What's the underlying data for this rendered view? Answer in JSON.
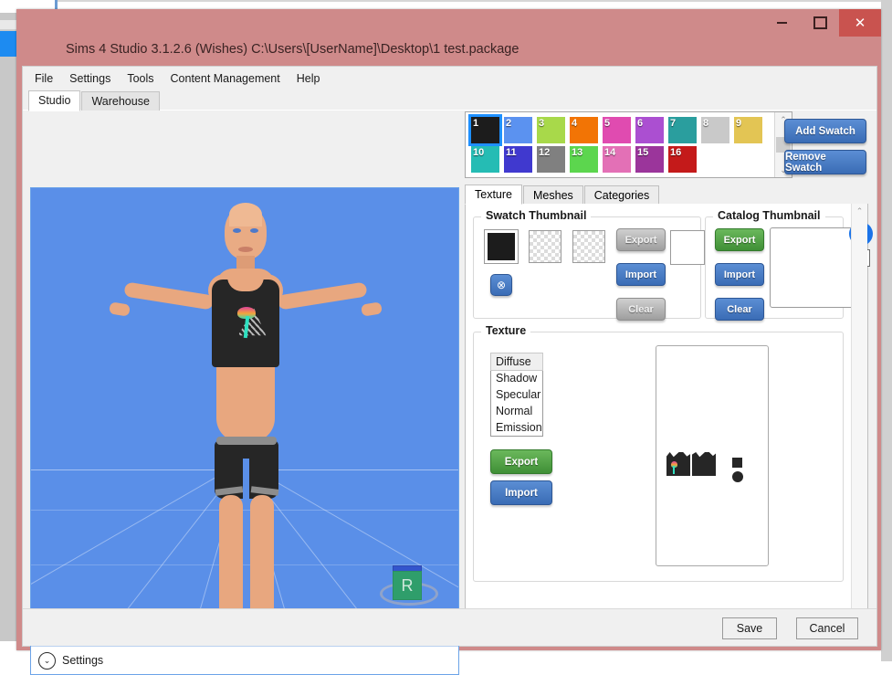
{
  "window": {
    "title": "Sims 4 Studio 3.1.2.6 (Wishes)  C:\\Users\\[UserName]\\Desktop\\1 test.package",
    "controls": {
      "minimize": "—",
      "maximize": "▢",
      "close": "✕"
    },
    "titlebar_color": "#cf8a8a",
    "close_color": "#c9534f"
  },
  "menubar": {
    "items": [
      {
        "label": "File"
      },
      {
        "label": "Settings"
      },
      {
        "label": "Tools"
      },
      {
        "label": "Content Management"
      },
      {
        "label": "Help"
      }
    ]
  },
  "main_tabs": [
    {
      "label": "Studio",
      "active": true
    },
    {
      "label": "Warehouse",
      "active": false
    }
  ],
  "viewport": {
    "settings_label": "Settings",
    "chevron": "⌄",
    "gizmo_label": "R",
    "background_color": "#5a8fe8",
    "gizmo_color": "#2f9e6b"
  },
  "swatches": {
    "items": [
      {
        "n": "1",
        "color": "#1c1c1c",
        "selected": true
      },
      {
        "n": "2",
        "color": "#5b92f0",
        "selected": false
      },
      {
        "n": "3",
        "color": "#a8d94a",
        "selected": false
      },
      {
        "n": "4",
        "color": "#f27405",
        "selected": false
      },
      {
        "n": "5",
        "color": "#e04bb0",
        "selected": false
      },
      {
        "n": "6",
        "color": "#ab4fd1",
        "selected": false
      },
      {
        "n": "7",
        "color": "#2a9e9e",
        "selected": false
      },
      {
        "n": "8",
        "color": "#c9c9c9",
        "selected": false
      },
      {
        "n": "9",
        "color": "#e3c554",
        "selected": false
      },
      {
        "n": "10",
        "color": "#25bcb4",
        "selected": false
      },
      {
        "n": "11",
        "color": "#4039cf",
        "selected": false
      },
      {
        "n": "12",
        "color": "#808080",
        "selected": false
      },
      {
        "n": "13",
        "color": "#5cd64e",
        "selected": false
      },
      {
        "n": "14",
        "color": "#e370b6",
        "selected": false
      },
      {
        "n": "15",
        "color": "#9b359b",
        "selected": false
      },
      {
        "n": "16",
        "color": "#c41a1a",
        "selected": false
      }
    ],
    "scroll_up": "⌃",
    "scroll_down": "⌄",
    "add_button": "Add Swatch",
    "remove_button": "Remove Swatch"
  },
  "inner_tabs": [
    {
      "label": "Texture",
      "active": true
    },
    {
      "label": "Meshes",
      "active": false
    },
    {
      "label": "Categories",
      "active": false
    }
  ],
  "swatch_thumbnail": {
    "legend": "Swatch Thumbnail",
    "export": "Export",
    "import": "Import",
    "clear": "Clear",
    "reset_icon": "⊗",
    "thumb1_color": "#1c1c1c"
  },
  "catalog_thumbnail": {
    "legend": "Catalog Thumbnail",
    "export": "Export",
    "import": "Import",
    "clear": "Clear",
    "crown_icon": "♛"
  },
  "texture": {
    "legend": "Texture",
    "list": [
      {
        "label": "Diffuse",
        "selected": true
      },
      {
        "label": "Shadow",
        "selected": false
      },
      {
        "label": "Specular",
        "selected": false
      },
      {
        "label": "Normal",
        "selected": false
      },
      {
        "label": "Emission",
        "selected": false
      }
    ],
    "export": "Export",
    "import": "Import"
  },
  "footer": {
    "save": "Save",
    "cancel": "Cancel"
  },
  "scrollbar": {
    "up": "⌃",
    "down": "⌄"
  }
}
